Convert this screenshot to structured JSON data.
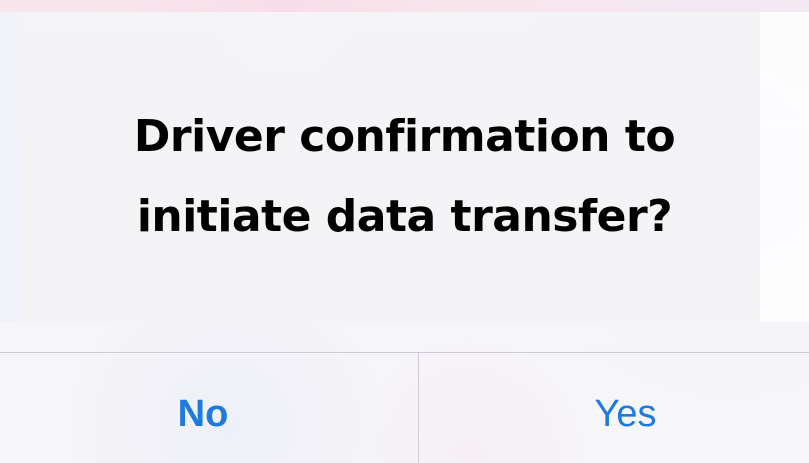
{
  "dialog": {
    "message_line_1": "Driver confirmation to",
    "message_line_2": "initiate data transfer?",
    "buttons": {
      "no_label": "No",
      "yes_label": "Yes"
    }
  },
  "colors": {
    "button_text": "#1f7ae0",
    "message_text": "#000000",
    "divider": "#cfcbd6"
  }
}
